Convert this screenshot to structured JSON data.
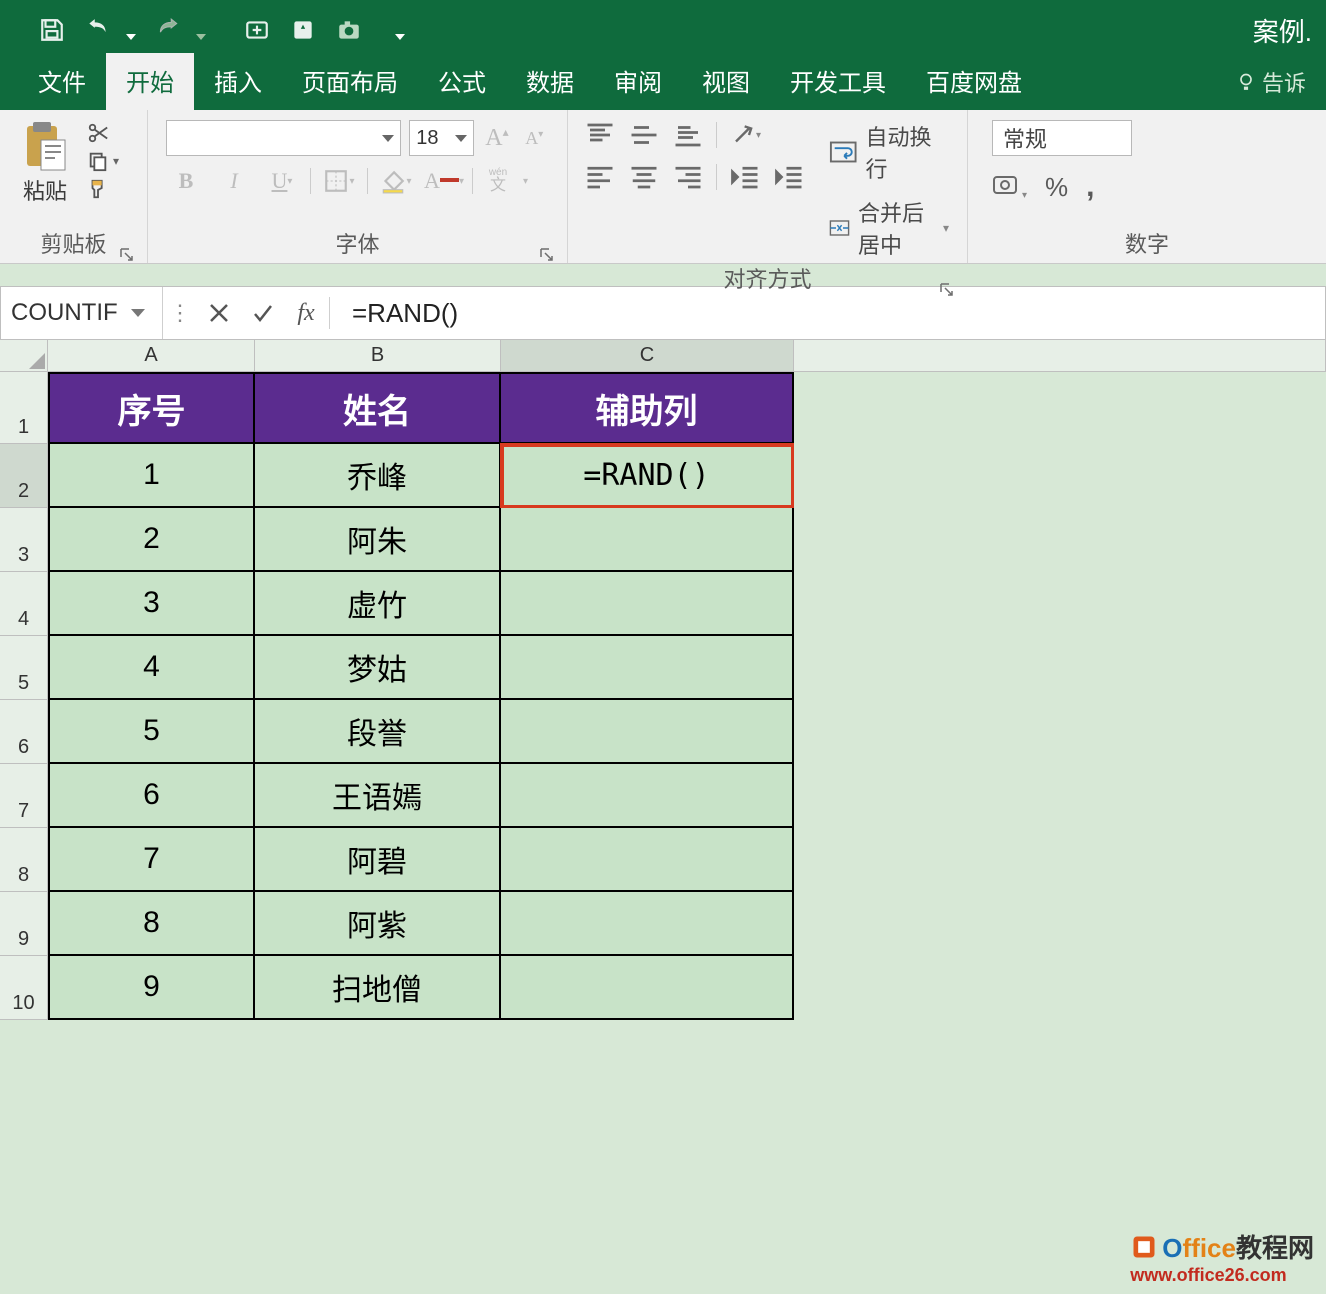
{
  "title_bar": {
    "doc_title": "案例."
  },
  "tabs": {
    "file": "文件",
    "home": "开始",
    "insert": "插入",
    "page_layout": "页面布局",
    "formulas": "公式",
    "data": "数据",
    "review": "审阅",
    "view": "视图",
    "developer": "开发工具",
    "baidu": "百度网盘",
    "tell_me": "告诉"
  },
  "ribbon": {
    "clipboard": {
      "paste": "粘贴",
      "group_label": "剪贴板"
    },
    "font": {
      "size": "18",
      "bold": "B",
      "italic": "I",
      "underline": "U",
      "phonetic": "wén",
      "phonetic2": "文",
      "increase": "A",
      "decrease": "A",
      "fontcolor": "A",
      "group_label": "字体"
    },
    "align": {
      "wrap": "自动换行",
      "merge": "合并后居中",
      "group_label": "对齐方式"
    },
    "number": {
      "format": "常规",
      "percent": "%",
      "comma": ",",
      "group_label": "数字"
    }
  },
  "fx_bar": {
    "name_box": "COUNTIF",
    "fx_label": "fx",
    "formula": "=RAND()"
  },
  "columns": {
    "A": "A",
    "B": "B",
    "C": "C"
  },
  "row_numbers": [
    "1",
    "2",
    "3",
    "4",
    "5",
    "6",
    "7",
    "8",
    "9",
    "10"
  ],
  "table": {
    "headers": {
      "A": "序号",
      "B": "姓名",
      "C": "辅助列"
    },
    "rows": [
      {
        "A": "1",
        "B": "乔峰",
        "C": "=RAND()"
      },
      {
        "A": "2",
        "B": "阿朱",
        "C": ""
      },
      {
        "A": "3",
        "B": "虚竹",
        "C": ""
      },
      {
        "A": "4",
        "B": "梦姑",
        "C": ""
      },
      {
        "A": "5",
        "B": "段誉",
        "C": ""
      },
      {
        "A": "6",
        "B": "王语嫣",
        "C": ""
      },
      {
        "A": "7",
        "B": "阿碧",
        "C": ""
      },
      {
        "A": "8",
        "B": "阿紫",
        "C": ""
      },
      {
        "A": "9",
        "B": "扫地僧",
        "C": ""
      }
    ]
  },
  "watermark": {
    "line1a": "O",
    "line1b": "ffice",
    "line1c": "教程网",
    "line2": "www.office26.com"
  }
}
